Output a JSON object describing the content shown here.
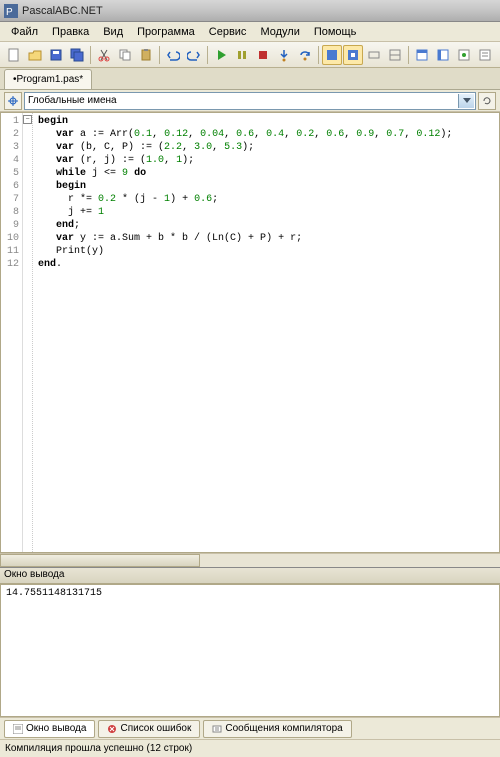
{
  "titlebar": {
    "title": "PascalABC.NET"
  },
  "menu": [
    "Файл",
    "Правка",
    "Вид",
    "Программа",
    "Сервис",
    "Модули",
    "Помощь"
  ],
  "toolbar_icons": [
    "new-file-icon",
    "open-file-icon",
    "save-icon",
    "save-all-icon",
    "cut-icon",
    "copy-icon",
    "paste-icon",
    "undo-icon",
    "redo-icon",
    "run-icon",
    "pause-icon",
    "stop-icon",
    "step-into-icon",
    "step-over-icon",
    "mode-a-icon",
    "mode-b-icon",
    "toggle-1-icon",
    "toggle-2-icon",
    "window-1-icon",
    "window-2-icon",
    "window-3-icon",
    "window-4-icon"
  ],
  "file_tab": "•Program1.pas*",
  "scope_combo": {
    "label": "Глобальные имена"
  },
  "code_lines": [
    {
      "n": 1,
      "html": "<span class='kw'>begin</span>"
    },
    {
      "n": 2,
      "html": "   <span class='kw'>var</span> a := Arr(<span class='num'>0.1</span>, <span class='num'>0.12</span>, <span class='num'>0.04</span>, <span class='num'>0.6</span>, <span class='num'>0.4</span>, <span class='num'>0.2</span>, <span class='num'>0.6</span>, <span class='num'>0.9</span>, <span class='num'>0.7</span>, <span class='num'>0.12</span>);"
    },
    {
      "n": 3,
      "html": "   <span class='kw'>var</span> (b, C, P) := (<span class='num'>2.2</span>, <span class='num'>3.0</span>, <span class='num'>5.3</span>);"
    },
    {
      "n": 4,
      "html": "   <span class='kw'>var</span> (r, j) := (<span class='num'>1.0</span>, <span class='num'>1</span>);"
    },
    {
      "n": 5,
      "html": "   <span class='kw'>while</span> j &lt;= <span class='num'>9</span> <span class='kw'>do</span>"
    },
    {
      "n": 6,
      "html": "   <span class='kw'>begin</span>"
    },
    {
      "n": 7,
      "html": "     r *= <span class='num'>0.2</span> * (j - <span class='num'>1</span>) + <span class='num'>0.6</span>;"
    },
    {
      "n": 8,
      "html": "     j += <span class='num'>1</span>"
    },
    {
      "n": 9,
      "html": "   <span class='kw'>end</span>;"
    },
    {
      "n": 10,
      "html": "   <span class='kw'>var</span> y := a.Sum + b * b / (Ln(C) + P) + r;"
    },
    {
      "n": 11,
      "html": "   Print(y)"
    },
    {
      "n": 12,
      "html": "<span class='kw'>end</span>."
    }
  ],
  "output": {
    "header": "Окно вывода",
    "text": "14.7551148131715"
  },
  "bottom_tabs": [
    {
      "label": "Окно вывода",
      "active": true,
      "icon": "output-icon"
    },
    {
      "label": "Список ошибок",
      "active": false,
      "icon": "errors-icon"
    },
    {
      "label": "Сообщения компилятора",
      "active": false,
      "icon": "messages-icon"
    }
  ],
  "status": "Компиляция прошла успешно (12 строк)"
}
